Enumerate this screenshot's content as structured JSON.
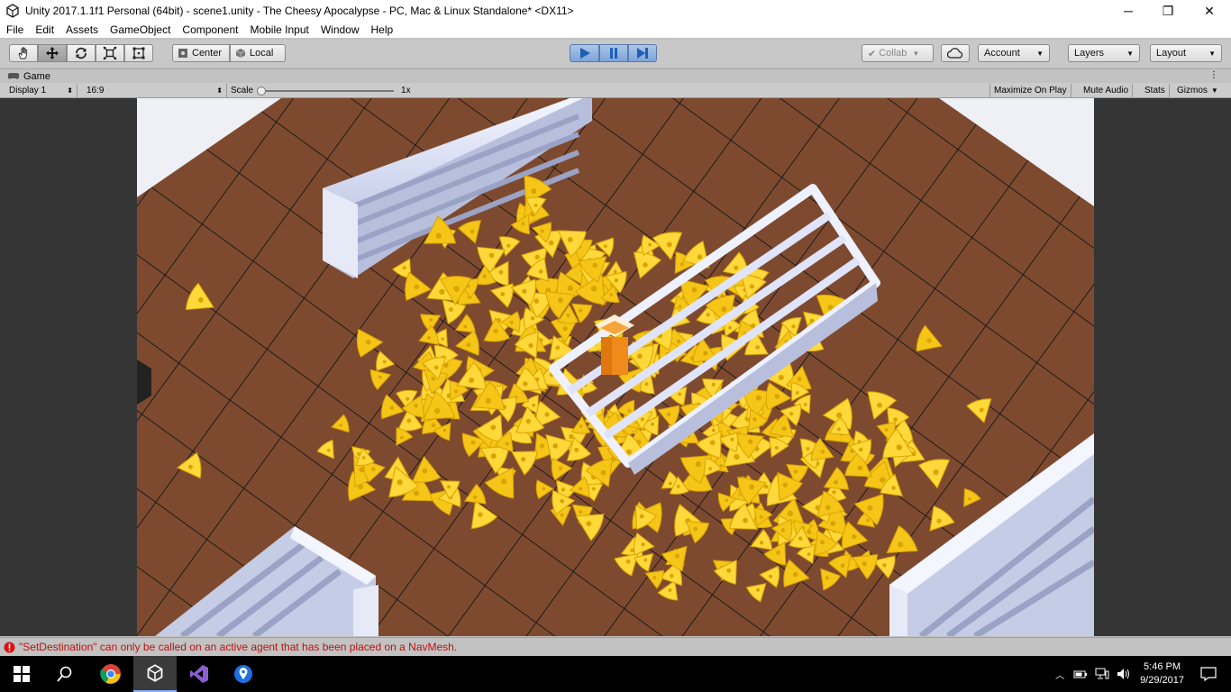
{
  "window": {
    "title": "Unity 2017.1.1f1 Personal (64bit) - scene1.unity - The Cheesy Apocalypse - PC, Mac & Linux Standalone* <DX11>",
    "minimize": "─",
    "maximize": "❐",
    "close": "✕"
  },
  "menu": [
    "File",
    "Edit",
    "Assets",
    "GameObject",
    "Component",
    "Mobile Input",
    "Window",
    "Help"
  ],
  "toolbar": {
    "pivot_center": "Center",
    "pivot_local": "Local",
    "collab": "Collab",
    "account": "Account",
    "layers": "Layers",
    "layout": "Layout"
  },
  "game_tab": {
    "label": "Game"
  },
  "game_controls": {
    "display": "Display 1",
    "aspect": "16:9",
    "scale_label": "Scale",
    "scale_value": "1x",
    "maximize_on_play": "Maximize On Play",
    "mute_audio": "Mute Audio",
    "stats": "Stats",
    "gizmos": "Gizmos"
  },
  "console": {
    "message": "\"SetDestination\" can only be called on an active agent that has been placed on a NavMesh."
  },
  "taskbar": {
    "time": "5:46 PM",
    "date": "9/29/2017"
  },
  "colors": {
    "accent_play": "#3a7fd4",
    "floor": "#7e4a2f",
    "cheese": "#f5c518",
    "error": "#c01010"
  }
}
